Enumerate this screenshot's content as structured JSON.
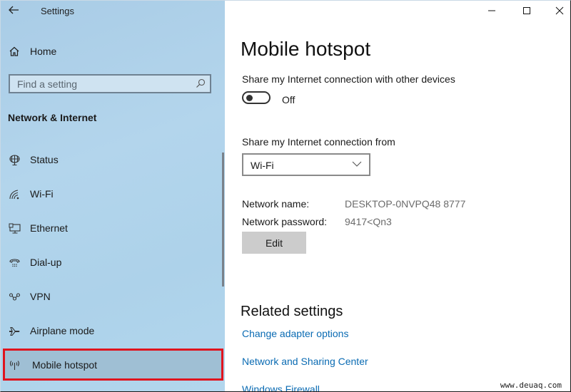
{
  "window": {
    "app_title": "Settings",
    "controls": {
      "minimize": "minimize",
      "maximize": "maximize",
      "close": "close"
    }
  },
  "sidebar": {
    "home_label": "Home",
    "search_placeholder": "Find a setting",
    "section_title": "Network & Internet",
    "items": [
      {
        "label": "Status",
        "icon": "globe-status-icon"
      },
      {
        "label": "Wi-Fi",
        "icon": "wifi-icon"
      },
      {
        "label": "Ethernet",
        "icon": "ethernet-icon"
      },
      {
        "label": "Dial-up",
        "icon": "dialup-phone-icon"
      },
      {
        "label": "VPN",
        "icon": "vpn-icon"
      },
      {
        "label": "Airplane mode",
        "icon": "airplane-icon"
      },
      {
        "label": "Mobile hotspot",
        "icon": "hotspot-icon",
        "selected": true
      }
    ]
  },
  "main": {
    "page_title": "Mobile hotspot",
    "share_label": "Share my Internet connection with other devices",
    "share_toggle_state": "Off",
    "share_from_label": "Share my Internet connection from",
    "share_from_value": "Wi-Fi",
    "network_name_label": "Network name:",
    "network_name_value": "DESKTOP-0NVPQ48 8777",
    "network_password_label": "Network password:",
    "network_password_value": "9417<Qn3",
    "edit_label": "Edit",
    "related_title": "Related settings",
    "related_links": [
      "Change adapter options",
      "Network and Sharing Center",
      "Windows Firewall"
    ]
  },
  "watermark": "www.deuaq.com"
}
